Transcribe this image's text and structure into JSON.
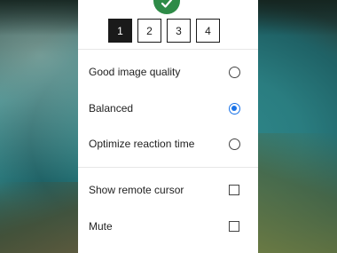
{
  "background": {
    "description_colors": {
      "water": "#2c7a7d",
      "ground": "#5b5a3e"
    }
  },
  "header": {
    "badge_icon": "shield-check-icon",
    "badge_color": "#2e8b47"
  },
  "display_selector": {
    "options": [
      "1",
      "2",
      "3",
      "4"
    ],
    "selected": "1"
  },
  "quality": {
    "options": [
      {
        "label": "Good image quality",
        "selected": false
      },
      {
        "label": "Balanced",
        "selected": true
      },
      {
        "label": "Optimize reaction time",
        "selected": false
      }
    ],
    "accent_color": "#1a73e8"
  },
  "settings": {
    "show_remote_cursor": {
      "label": "Show remote cursor",
      "checked": false
    },
    "mute": {
      "label": "Mute",
      "checked": false
    }
  }
}
